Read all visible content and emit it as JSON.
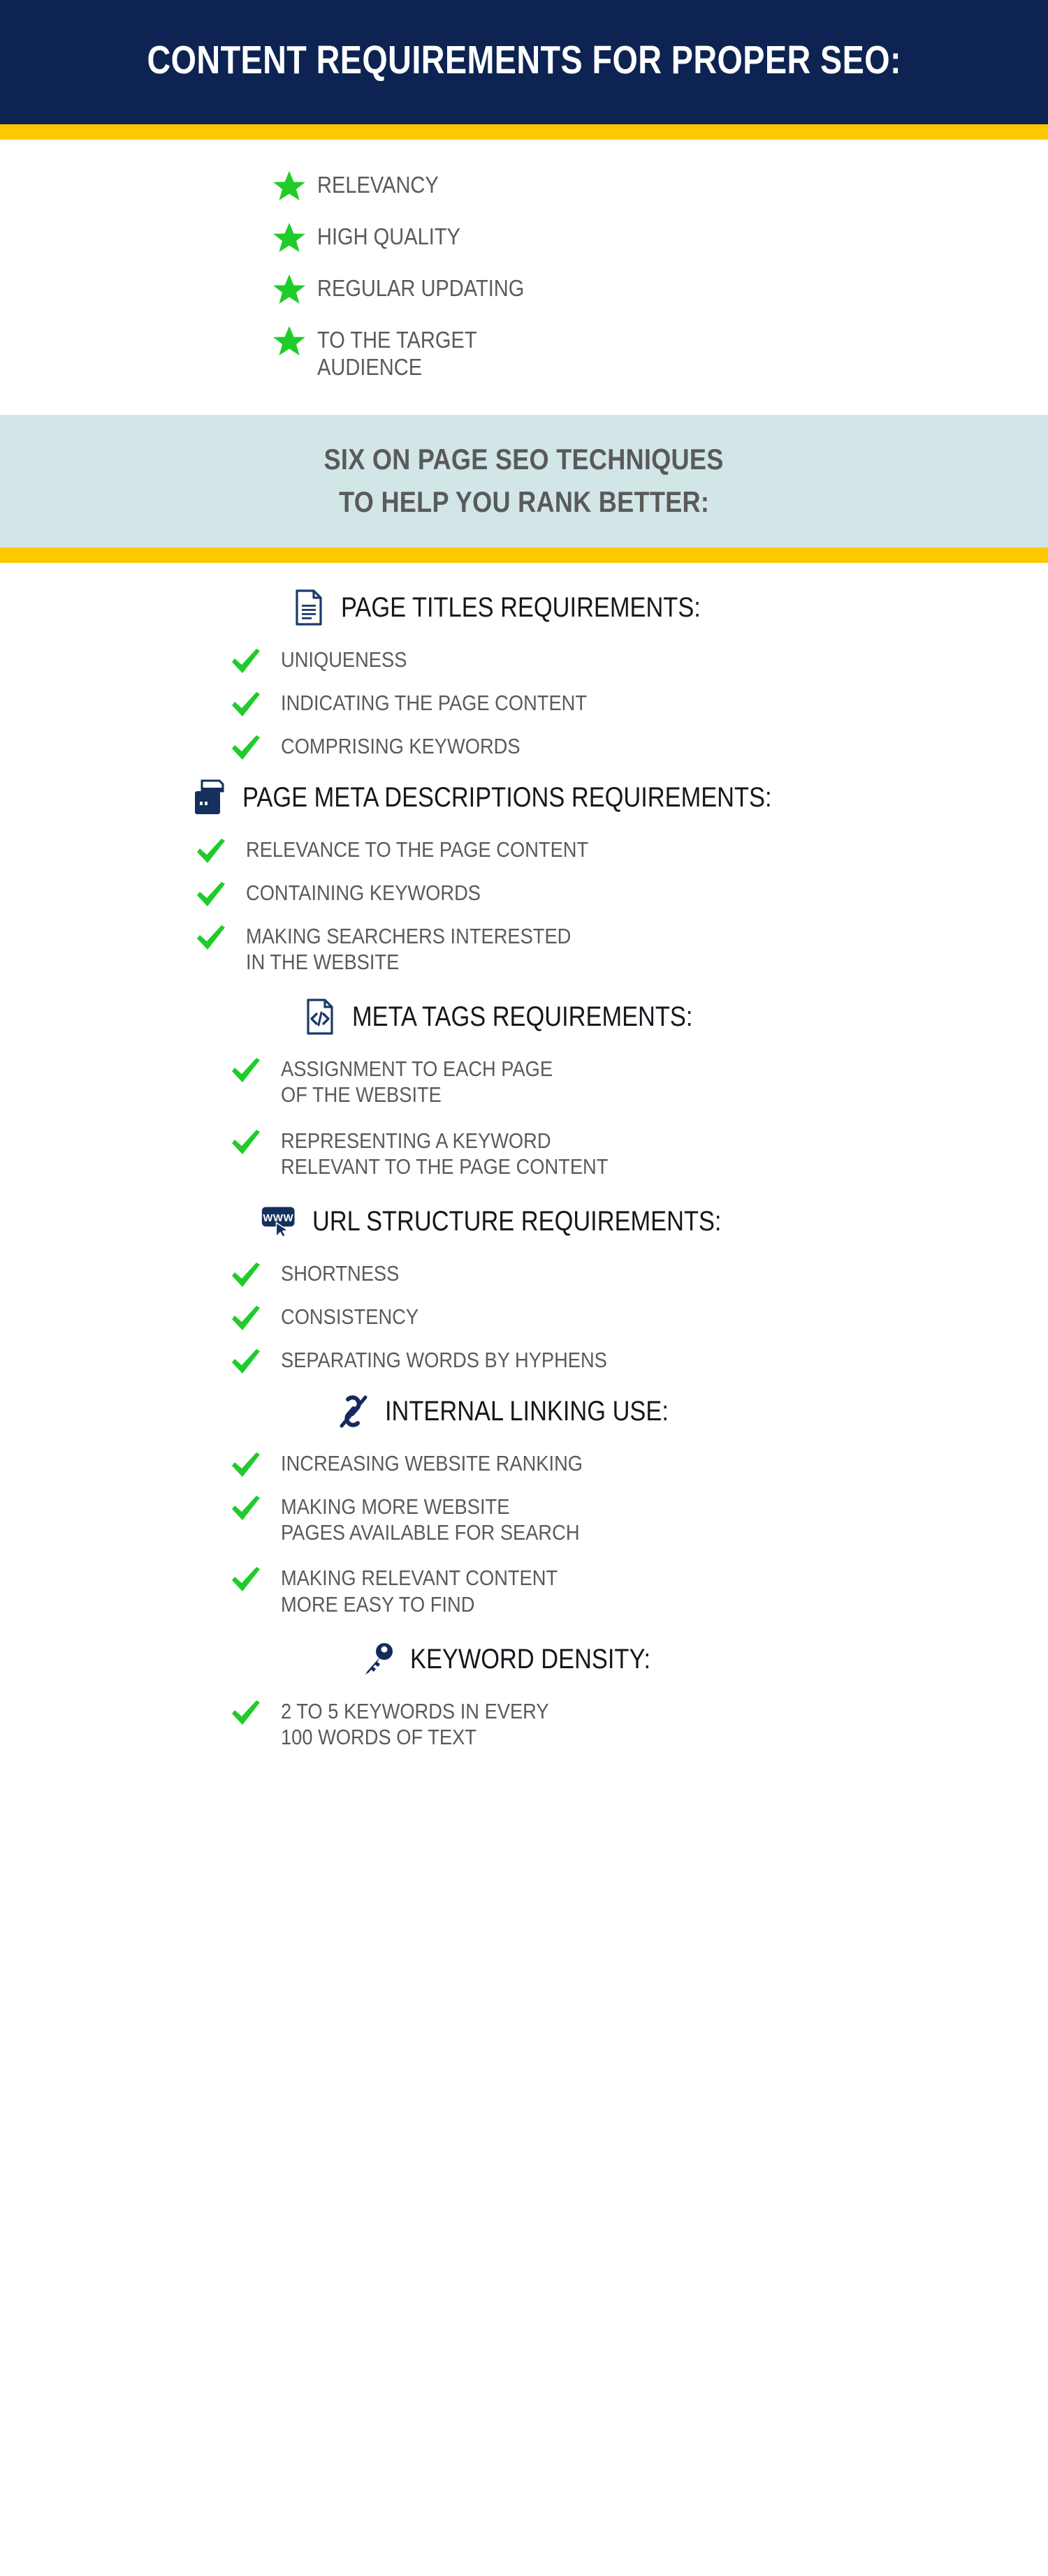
{
  "colors": {
    "navy": "#0d2352",
    "yellow": "#fdc800",
    "light_blue": "#d2e6e8",
    "green": "#1fcc2a",
    "body_text": "#5a5a5a",
    "heading_text": "#14181c",
    "white": "#ffffff"
  },
  "header": {
    "title": "CONTENT REQUIREMENTS FOR PROPER SEO:"
  },
  "content_requirements": {
    "bullet_icon": "star-icon",
    "items": [
      "RELEVANCY",
      "HIGH QUALITY",
      "REGULAR UPDATING",
      "TO THE TARGET\nAUDIENCE"
    ]
  },
  "subtitle": {
    "line1": "SIX ON PAGE SEO TECHNIQUES",
    "line2": "TO HELP YOU RANK BETTER:"
  },
  "techniques": [
    {
      "icon": "document-icon",
      "title": "PAGE TITLES REQUIREMENTS:",
      "items": [
        "UNIQUENESS",
        "INDICATING THE PAGE CONTENT",
        "COMPRISING KEYWORDS"
      ]
    },
    {
      "icon": "printer-icon",
      "title": "PAGE META DESCRIPTIONS REQUIREMENTS:",
      "items": [
        "RELEVANCE TO THE PAGE CONTENT",
        "CONTAINING KEYWORDS",
        "MAKING SEARCHERS INTERESTED\nIN THE WEBSITE"
      ]
    },
    {
      "icon": "code-document-icon",
      "title": "META TAGS REQUIREMENTS:",
      "items": [
        "ASSIGNMENT TO EACH PAGE\nOF THE WEBSITE",
        "REPRESENTING A KEYWORD\nRELEVANT TO THE PAGE CONTENT"
      ]
    },
    {
      "icon": "www-cursor-icon",
      "icon_label": "WWW",
      "title": "URL STRUCTURE REQUIREMENTS:",
      "items": [
        "SHORTNESS",
        "CONSISTENCY",
        "SEPARATING WORDS BY HYPHENS"
      ]
    },
    {
      "icon": "chain-link-icon",
      "title": "INTERNAL LINKING USE:",
      "items": [
        "INCREASING WEBSITE RANKING",
        "MAKING MORE WEBSITE\nPAGES AVAILABLE FOR SEARCH",
        "MAKING RELEVANT CONTENT\nMORE EASY TO FIND"
      ]
    },
    {
      "icon": "key-icon",
      "title": "KEYWORD DENSITY:",
      "items": [
        "2 TO 5 KEYWORDS IN EVERY\n100 WORDS OF TEXT"
      ]
    }
  ]
}
